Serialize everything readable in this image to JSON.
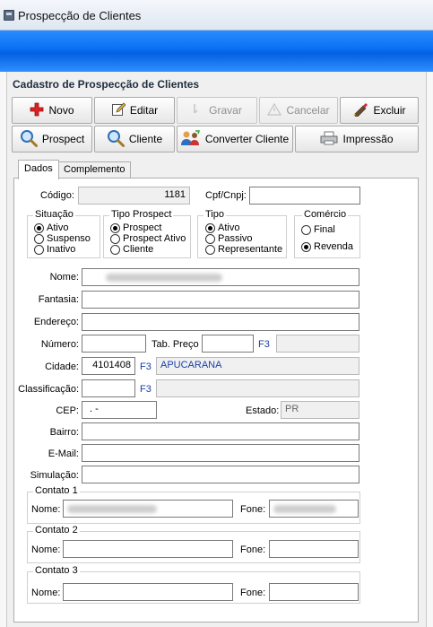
{
  "window": {
    "title": "Prospecção de Clientes"
  },
  "form_title": "Cadastro de Prospecção de Clientes",
  "toolbar": {
    "row1": [
      {
        "label": "Novo",
        "icon": "plus-icon",
        "enabled": true
      },
      {
        "label": "Editar",
        "icon": "edit-icon",
        "enabled": true
      },
      {
        "label": "Gravar",
        "icon": "save-icon",
        "enabled": false
      },
      {
        "label": "Cancelar",
        "icon": "cancel-icon",
        "enabled": false
      },
      {
        "label": "Excluir",
        "icon": "delete-icon",
        "enabled": true
      }
    ],
    "row2": [
      {
        "label": "Prospect",
        "icon": "magnifier-icon"
      },
      {
        "label": "Cliente",
        "icon": "magnifier-icon"
      },
      {
        "label": "Converter Cliente",
        "icon": "users-convert-icon"
      },
      {
        "label": "Impressão",
        "icon": "printer-icon"
      }
    ]
  },
  "tabs": [
    {
      "label": "Dados",
      "active": true
    },
    {
      "label": "Complemento",
      "active": false
    }
  ],
  "fields": {
    "codigo": {
      "label": "Código:",
      "value": "1181"
    },
    "cpf": {
      "label": "Cpf/Cnpj:",
      "value": ""
    },
    "nome": {
      "label": "Nome:",
      "value": ""
    },
    "fantasia": {
      "label": "Fantasia:",
      "value": ""
    },
    "endereco": {
      "label": "Endereço:",
      "value": ""
    },
    "numero": {
      "label": "Número:",
      "value": ""
    },
    "tab_preco": {
      "label": "Tab. Preço",
      "value": "",
      "lookup": "F3",
      "desc": ""
    },
    "cidade": {
      "label": "Cidade:",
      "value": "4101408",
      "lookup": "F3",
      "desc": "APUCARANA"
    },
    "classificacao": {
      "label": "Classificação:",
      "value": "",
      "lookup": "F3",
      "desc": ""
    },
    "cep": {
      "label": "CEP:",
      "value": ".   -"
    },
    "estado": {
      "label": "Estado:",
      "value": "PR"
    },
    "bairro": {
      "label": "Bairro:",
      "value": ""
    },
    "email": {
      "label": "E-Mail:",
      "value": ""
    },
    "simulacao": {
      "label": "Simulação:",
      "value": ""
    }
  },
  "groups": {
    "situacao": {
      "title": "Situação",
      "options": [
        "Ativo",
        "Suspenso",
        "Inativo"
      ],
      "selected": "Ativo"
    },
    "tipo_prospect": {
      "title": "Tipo Prospect",
      "options": [
        "Prospect",
        "Prospect Ativo",
        "Cliente"
      ],
      "selected": "Prospect"
    },
    "tipo": {
      "title": "Tipo",
      "options": [
        "Ativo",
        "Passivo",
        "Representante"
      ],
      "selected": "Ativo"
    },
    "comercio": {
      "title": "Comércio",
      "options": [
        "Final",
        "Revenda"
      ],
      "selected": "Revenda"
    }
  },
  "contatos": [
    {
      "title": "Contato 1",
      "nome_label": "Nome:",
      "fone_label": "Fone:",
      "nome": "",
      "fone": ""
    },
    {
      "title": "Contato 2",
      "nome_label": "Nome:",
      "fone_label": "Fone:",
      "nome": "",
      "fone": ""
    },
    {
      "title": "Contato 3",
      "nome_label": "Nome:",
      "fone_label": "Fone:",
      "nome": "",
      "fone": ""
    }
  ]
}
